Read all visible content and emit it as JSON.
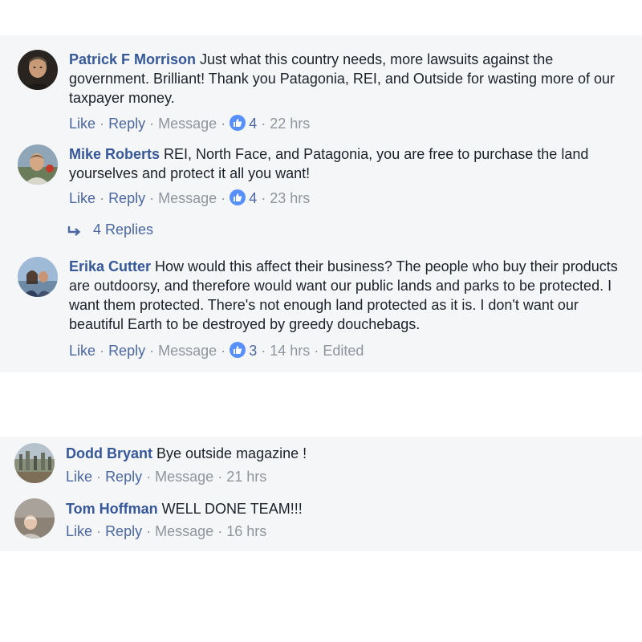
{
  "comments": [
    {
      "name": "Patrick F Morrison",
      "text": " Just what this country needs, more lawsuits against the government. Brilliant! Thank you Patagonia, REI, and Outside for wasting more of our taxpayer money.",
      "like": "Like",
      "reply": "Reply",
      "message": "Message",
      "likes": "4",
      "time": "22 hrs"
    },
    {
      "name": "Mike Roberts",
      "text": " REI, North Face, and Patagonia, you are free to purchase the land yourselves and protect it all you want!",
      "like": "Like",
      "reply": "Reply",
      "message": "Message",
      "likes": "4",
      "time": "23 hrs",
      "replies": "4 Replies"
    },
    {
      "name": "Erika Cutter",
      "text": " How would this affect their business? The people who buy their products are outdoorsy, and therefore would want our public lands and parks to be protected. I want them protected. There's not enough land protected as it is. I don't want our beautiful Earth to be destroyed by greedy douchebags.",
      "like": "Like",
      "reply": "Reply",
      "message": "Message",
      "likes": "3",
      "time": "14 hrs",
      "edited": "Edited"
    },
    {
      "name": "Dodd Bryant",
      "text": " Bye outside magazine !",
      "like": "Like",
      "reply": "Reply",
      "message": "Message",
      "time": "21 hrs"
    },
    {
      "name": "Tom Hoffman",
      "text": " WELL DONE TEAM!!!",
      "like": "Like",
      "reply": "Reply",
      "message": "Message",
      "time": "16 hrs"
    }
  ],
  "colors": {
    "name": "#365899",
    "link": "#4b67a1",
    "meta": "#90949c",
    "panel": "#f5f6f7",
    "like_badge": "#5890ff"
  },
  "icons": {
    "like_badge": "thumbs-up-icon",
    "reply_arrow": "reply-arrow-icon"
  }
}
